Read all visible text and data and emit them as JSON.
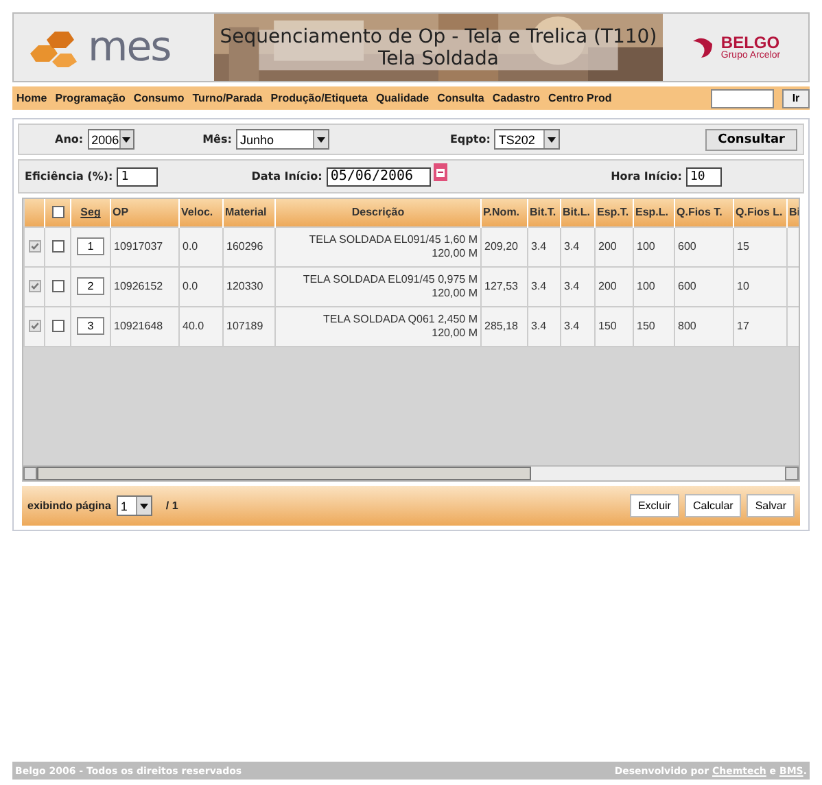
{
  "header": {
    "logo_text": "mes",
    "title": "Sequenciamento de Op - Tela e Trelica (T110)",
    "subtitle": "Tela Soldada",
    "brand": "BELGO",
    "brand_sub": "Grupo Arcelor"
  },
  "menu": {
    "items": [
      "Home",
      "Programação",
      "Consumo",
      "Turno/Parada",
      "Produção/Etiqueta",
      "Qualidade",
      "Consulta",
      "Cadastro",
      "Centro Prod"
    ],
    "go_button": "Ir"
  },
  "filters": {
    "year": {
      "label": "Ano:",
      "value": "2006"
    },
    "month": {
      "label": "Mês:",
      "value": "Junho"
    },
    "equipment": {
      "label": "Eqpto:",
      "value": "TS202"
    },
    "query_button": "Consultar"
  },
  "params": {
    "efficiency": {
      "label": "Eficiência (%):",
      "value": "1"
    },
    "start_date": {
      "label": "Data Início:",
      "value": "05/06/2006"
    },
    "start_hour": {
      "label": "Hora Início:",
      "value": "10"
    }
  },
  "table": {
    "select_all_checked": false,
    "columns": [
      "Seg",
      "OP",
      "Veloc.",
      "Material",
      "Descrição",
      "P.Nom.",
      "Bit.T.",
      "Bit.L.",
      "Esp.T.",
      "Esp.L.",
      "Q.Fios T.",
      "Q.Fios L.",
      "Bi"
    ],
    "rows": [
      {
        "locked": true,
        "checked": false,
        "cells": [
          "1",
          "10917037",
          "0.0",
          "160296",
          "TELA SOLDADA EL091/45 1,60 M 120,00 M",
          "209,20",
          "3.4",
          "3.4",
          "200",
          "100",
          "600",
          "15"
        ]
      },
      {
        "locked": true,
        "checked": false,
        "cells": [
          "2",
          "10926152",
          "0.0",
          "120330",
          "TELA SOLDADA EL091/45 0,975 M 120,00 M",
          "127,53",
          "3.4",
          "3.4",
          "200",
          "100",
          "600",
          "10"
        ]
      },
      {
        "locked": true,
        "checked": false,
        "cells": [
          "3",
          "10921648",
          "40.0",
          "107189",
          "TELA SOLDADA Q061 2,450 M 120,00 M",
          "285,18",
          "3.4",
          "3.4",
          "150",
          "150",
          "800",
          "17"
        ]
      }
    ]
  },
  "pager": {
    "label": "exibindo página",
    "page": "1",
    "total": "/ 1",
    "buttons": [
      "Excluir",
      "Calcular",
      "Salvar"
    ]
  },
  "footer": {
    "copyright": "Belgo 2006 - Todos os direitos reservados",
    "credit_prefix": "Desenvolvido por",
    "links": [
      "Chemtech",
      "BMS"
    ],
    "joiner": "e",
    "end": "."
  }
}
